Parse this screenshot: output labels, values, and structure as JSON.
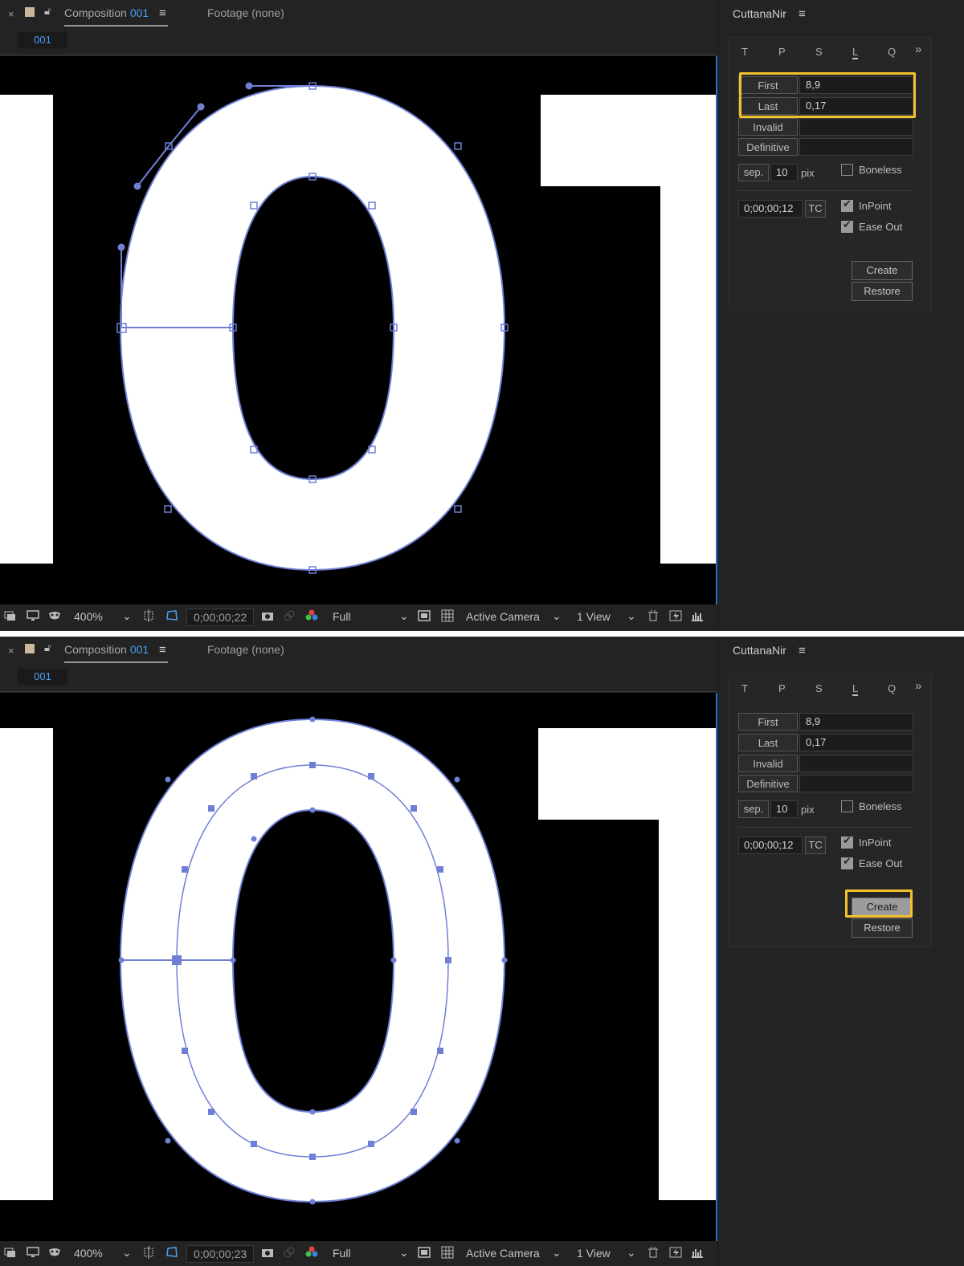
{
  "colors": {
    "accent": "#4a9ff5",
    "highlight": "#f2c12e",
    "path": "#6f7fd6",
    "panel": "#232323"
  },
  "shots": [
    {
      "comp": {
        "close": "×",
        "tab_label": "Composition",
        "tab_num": "001",
        "menu": "≡",
        "footage_tab": "Footage  (none)",
        "subtab": "001"
      },
      "status": {
        "zoom": "400%",
        "time": "0;00;00;22",
        "resolution": "Full",
        "camera": "Active Camera",
        "views": "1 View"
      },
      "panel": {
        "title": "CuttanaNir",
        "menu": "≡",
        "tabs": [
          "T",
          "P",
          "S",
          "L",
          "Q"
        ],
        "selected_tab": "L",
        "more": "»",
        "first_label": "First",
        "first_value": "8,9",
        "last_label": "Last",
        "last_value": "0,17",
        "invalid_label": "Invalid",
        "invalid_value": "",
        "definitive_label": "Definitive",
        "definitive_value": "",
        "sep_label": "sep.",
        "sep_value": "10",
        "pix_label": "pix",
        "boneless_label": "Boneless",
        "boneless_checked": false,
        "timecode": "0;00;00;12",
        "tc_label": "TC",
        "inpoint_label": "InPoint",
        "inpoint_checked": true,
        "easeout_label": "Ease Out",
        "easeout_checked": true,
        "create_label": "Create",
        "restore_label": "Restore",
        "highlight": "first-last"
      }
    },
    {
      "comp": {
        "close": "×",
        "tab_label": "Composition",
        "tab_num": "001",
        "menu": "≡",
        "footage_tab": "Footage  (none)",
        "subtab": "001"
      },
      "status": {
        "zoom": "400%",
        "time": "0;00;00;23",
        "resolution": "Full",
        "camera": "Active Camera",
        "views": "1 View"
      },
      "panel": {
        "title": "CuttanaNir",
        "menu": "≡",
        "tabs": [
          "T",
          "P",
          "S",
          "L",
          "Q"
        ],
        "selected_tab": "L",
        "more": "»",
        "first_label": "First",
        "first_value": "8,9",
        "last_label": "Last",
        "last_value": "0,17",
        "invalid_label": "Invalid",
        "invalid_value": "",
        "definitive_label": "Definitive",
        "definitive_value": "",
        "sep_label": "sep.",
        "sep_value": "10",
        "pix_label": "pix",
        "boneless_label": "Boneless",
        "boneless_checked": false,
        "timecode": "0;00;00;12",
        "tc_label": "TC",
        "inpoint_label": "InPoint",
        "inpoint_checked": true,
        "easeout_label": "Ease Out",
        "easeout_checked": true,
        "create_label": "Create",
        "restore_label": "Restore",
        "highlight": "create"
      }
    }
  ]
}
